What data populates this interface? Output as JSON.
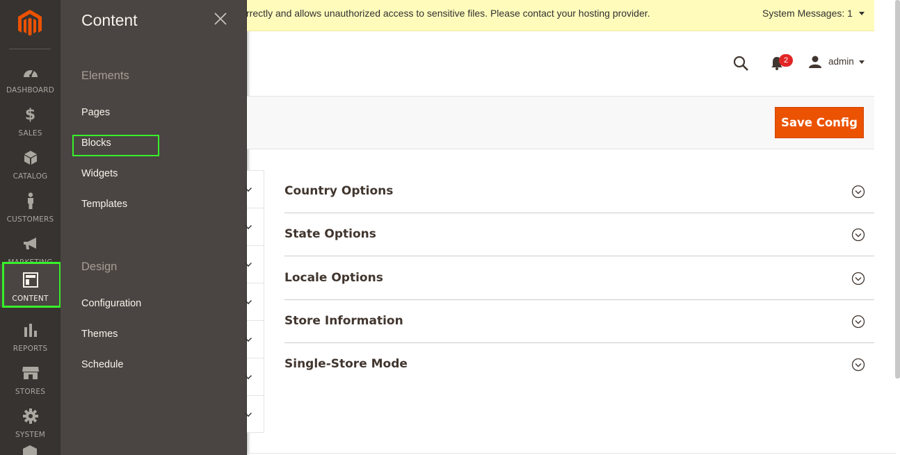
{
  "nav": {
    "items": [
      {
        "label": "DASHBOARD",
        "icon": "dashboard-icon"
      },
      {
        "label": "SALES",
        "icon": "dollar-icon"
      },
      {
        "label": "CATALOG",
        "icon": "cube-icon"
      },
      {
        "label": "CUSTOMERS",
        "icon": "person-icon"
      },
      {
        "label": "MARKETING",
        "icon": "megaphone-icon"
      },
      {
        "label": "CONTENT",
        "icon": "layout-icon"
      },
      {
        "label": "REPORTS",
        "icon": "bar-chart-icon"
      },
      {
        "label": "STORES",
        "icon": "storefront-icon"
      },
      {
        "label": "SYSTEM",
        "icon": "gear-icon"
      }
    ],
    "active": "CONTENT"
  },
  "flyout": {
    "title": "Content",
    "groups": [
      {
        "title": "Elements",
        "links": [
          "Pages",
          "Blocks",
          "Widgets",
          "Templates"
        ]
      },
      {
        "title": "Design",
        "links": [
          "Configuration",
          "Themes",
          "Schedule"
        ]
      }
    ],
    "highlighted": "Blocks"
  },
  "system_message": {
    "text": "rrectly and allows unauthorized access to sensitive files. Please contact your hosting provider.",
    "count_label": "System Messages: 1"
  },
  "header": {
    "notification_count": "2",
    "user": "admin"
  },
  "actions": {
    "save_label": "Save Config"
  },
  "sections": [
    {
      "title": "Country Options"
    },
    {
      "title": "State Options"
    },
    {
      "title": "Locale Options"
    },
    {
      "title": "Store Information"
    },
    {
      "title": "Single-Store Mode"
    }
  ],
  "colors": {
    "nav_bg": "#373330",
    "flyout_bg": "#4a4542",
    "accent": "#eb5202",
    "highlight": "#38f02a",
    "message_bg": "#fffbbb"
  }
}
